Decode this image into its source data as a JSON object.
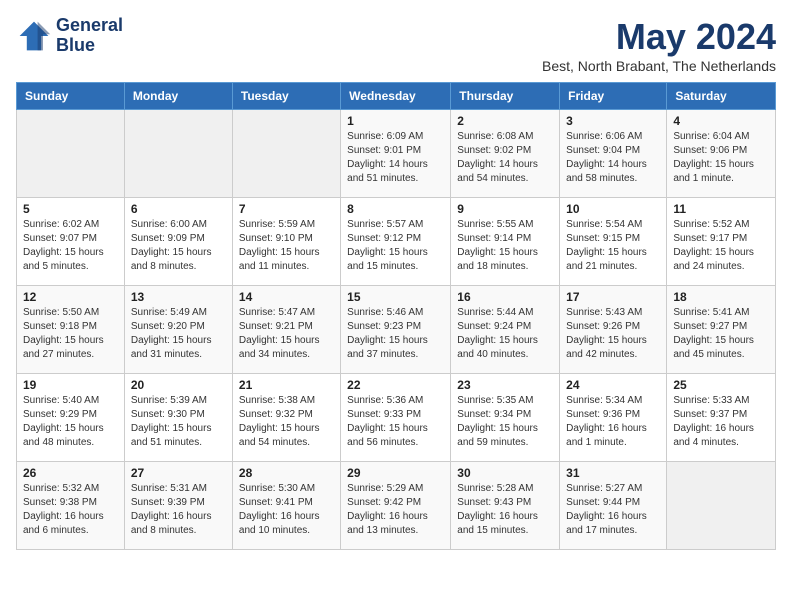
{
  "header": {
    "logo_line1": "General",
    "logo_line2": "Blue",
    "month_year": "May 2024",
    "location": "Best, North Brabant, The Netherlands"
  },
  "weekdays": [
    "Sunday",
    "Monday",
    "Tuesday",
    "Wednesday",
    "Thursday",
    "Friday",
    "Saturday"
  ],
  "weeks": [
    [
      {
        "day": "",
        "info": ""
      },
      {
        "day": "",
        "info": ""
      },
      {
        "day": "",
        "info": ""
      },
      {
        "day": "1",
        "info": "Sunrise: 6:09 AM\nSunset: 9:01 PM\nDaylight: 14 hours\nand 51 minutes."
      },
      {
        "day": "2",
        "info": "Sunrise: 6:08 AM\nSunset: 9:02 PM\nDaylight: 14 hours\nand 54 minutes."
      },
      {
        "day": "3",
        "info": "Sunrise: 6:06 AM\nSunset: 9:04 PM\nDaylight: 14 hours\nand 58 minutes."
      },
      {
        "day": "4",
        "info": "Sunrise: 6:04 AM\nSunset: 9:06 PM\nDaylight: 15 hours\nand 1 minute."
      }
    ],
    [
      {
        "day": "5",
        "info": "Sunrise: 6:02 AM\nSunset: 9:07 PM\nDaylight: 15 hours\nand 5 minutes."
      },
      {
        "day": "6",
        "info": "Sunrise: 6:00 AM\nSunset: 9:09 PM\nDaylight: 15 hours\nand 8 minutes."
      },
      {
        "day": "7",
        "info": "Sunrise: 5:59 AM\nSunset: 9:10 PM\nDaylight: 15 hours\nand 11 minutes."
      },
      {
        "day": "8",
        "info": "Sunrise: 5:57 AM\nSunset: 9:12 PM\nDaylight: 15 hours\nand 15 minutes."
      },
      {
        "day": "9",
        "info": "Sunrise: 5:55 AM\nSunset: 9:14 PM\nDaylight: 15 hours\nand 18 minutes."
      },
      {
        "day": "10",
        "info": "Sunrise: 5:54 AM\nSunset: 9:15 PM\nDaylight: 15 hours\nand 21 minutes."
      },
      {
        "day": "11",
        "info": "Sunrise: 5:52 AM\nSunset: 9:17 PM\nDaylight: 15 hours\nand 24 minutes."
      }
    ],
    [
      {
        "day": "12",
        "info": "Sunrise: 5:50 AM\nSunset: 9:18 PM\nDaylight: 15 hours\nand 27 minutes."
      },
      {
        "day": "13",
        "info": "Sunrise: 5:49 AM\nSunset: 9:20 PM\nDaylight: 15 hours\nand 31 minutes."
      },
      {
        "day": "14",
        "info": "Sunrise: 5:47 AM\nSunset: 9:21 PM\nDaylight: 15 hours\nand 34 minutes."
      },
      {
        "day": "15",
        "info": "Sunrise: 5:46 AM\nSunset: 9:23 PM\nDaylight: 15 hours\nand 37 minutes."
      },
      {
        "day": "16",
        "info": "Sunrise: 5:44 AM\nSunset: 9:24 PM\nDaylight: 15 hours\nand 40 minutes."
      },
      {
        "day": "17",
        "info": "Sunrise: 5:43 AM\nSunset: 9:26 PM\nDaylight: 15 hours\nand 42 minutes."
      },
      {
        "day": "18",
        "info": "Sunrise: 5:41 AM\nSunset: 9:27 PM\nDaylight: 15 hours\nand 45 minutes."
      }
    ],
    [
      {
        "day": "19",
        "info": "Sunrise: 5:40 AM\nSunset: 9:29 PM\nDaylight: 15 hours\nand 48 minutes."
      },
      {
        "day": "20",
        "info": "Sunrise: 5:39 AM\nSunset: 9:30 PM\nDaylight: 15 hours\nand 51 minutes."
      },
      {
        "day": "21",
        "info": "Sunrise: 5:38 AM\nSunset: 9:32 PM\nDaylight: 15 hours\nand 54 minutes."
      },
      {
        "day": "22",
        "info": "Sunrise: 5:36 AM\nSunset: 9:33 PM\nDaylight: 15 hours\nand 56 minutes."
      },
      {
        "day": "23",
        "info": "Sunrise: 5:35 AM\nSunset: 9:34 PM\nDaylight: 15 hours\nand 59 minutes."
      },
      {
        "day": "24",
        "info": "Sunrise: 5:34 AM\nSunset: 9:36 PM\nDaylight: 16 hours\nand 1 minute."
      },
      {
        "day": "25",
        "info": "Sunrise: 5:33 AM\nSunset: 9:37 PM\nDaylight: 16 hours\nand 4 minutes."
      }
    ],
    [
      {
        "day": "26",
        "info": "Sunrise: 5:32 AM\nSunset: 9:38 PM\nDaylight: 16 hours\nand 6 minutes."
      },
      {
        "day": "27",
        "info": "Sunrise: 5:31 AM\nSunset: 9:39 PM\nDaylight: 16 hours\nand 8 minutes."
      },
      {
        "day": "28",
        "info": "Sunrise: 5:30 AM\nSunset: 9:41 PM\nDaylight: 16 hours\nand 10 minutes."
      },
      {
        "day": "29",
        "info": "Sunrise: 5:29 AM\nSunset: 9:42 PM\nDaylight: 16 hours\nand 13 minutes."
      },
      {
        "day": "30",
        "info": "Sunrise: 5:28 AM\nSunset: 9:43 PM\nDaylight: 16 hours\nand 15 minutes."
      },
      {
        "day": "31",
        "info": "Sunrise: 5:27 AM\nSunset: 9:44 PM\nDaylight: 16 hours\nand 17 minutes."
      },
      {
        "day": "",
        "info": ""
      }
    ]
  ]
}
